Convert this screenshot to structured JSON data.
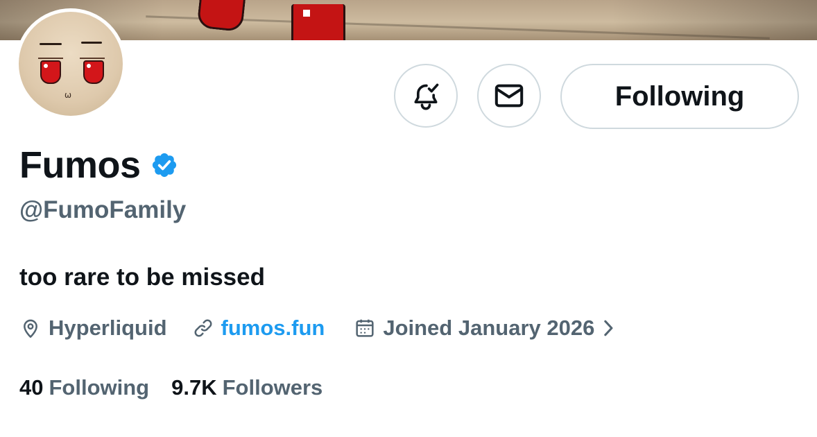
{
  "profile": {
    "display_name": "Fumos",
    "verified": true,
    "handle": "@FumoFamily",
    "bio": "too rare to be missed",
    "location": "Hyperliquid",
    "website": "fumos.fun",
    "joined": "Joined January 2026"
  },
  "actions": {
    "notify_icon": "bell-check-icon",
    "message_icon": "envelope-icon",
    "follow_label": "Following"
  },
  "stats": {
    "following_count": "40",
    "following_label": "Following",
    "followers_count": "9.7K",
    "followers_label": "Followers"
  },
  "colors": {
    "text_primary": "#0f1419",
    "text_secondary": "#536471",
    "link": "#1d9bf0",
    "verified_badge": "#1d9bf0",
    "button_border": "#cfd9de"
  }
}
